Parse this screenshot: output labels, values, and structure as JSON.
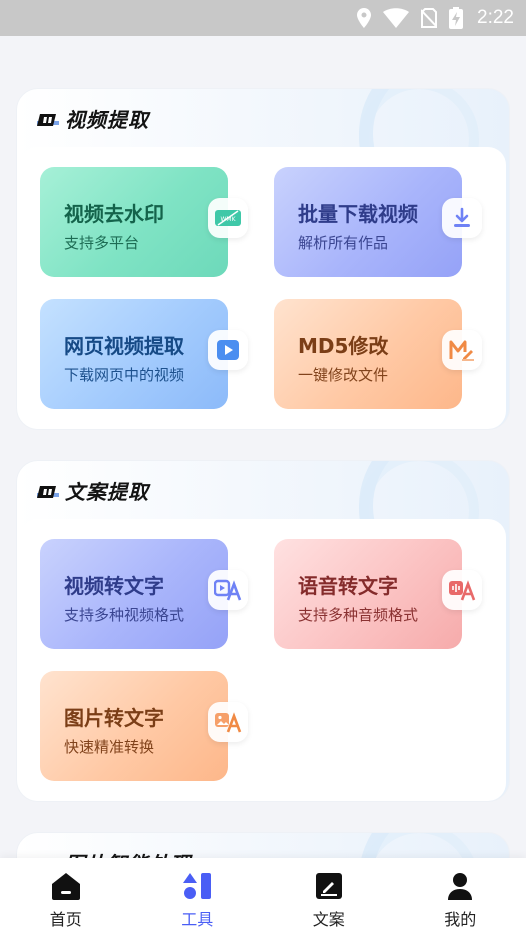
{
  "status_bar": {
    "time": "2:22"
  },
  "sections": [
    {
      "title": "视频提取",
      "cards": [
        {
          "title": "视频去水印",
          "subtitle": "支持多平台",
          "icon": "remove-watermark-icon"
        },
        {
          "title": "批量下载视频",
          "subtitle": "解析所有作品",
          "icon": "download-icon"
        },
        {
          "title": "网页视频提取",
          "subtitle": "下载网页中的视频",
          "icon": "play-icon"
        },
        {
          "title": "MD5修改",
          "subtitle": "一键修改文件",
          "icon": "md5-edit-icon"
        }
      ]
    },
    {
      "title": "文案提取",
      "cards": [
        {
          "title": "视频转文字",
          "subtitle": "支持多种视频格式",
          "icon": "video-to-text-icon"
        },
        {
          "title": "语音转文字",
          "subtitle": "支持多种音频格式",
          "icon": "audio-to-text-icon"
        },
        {
          "title": "图片转文字",
          "subtitle": "快速精准转换",
          "icon": "image-to-text-icon"
        }
      ]
    },
    {
      "title": "图片智能处理"
    }
  ],
  "bottom_nav": [
    {
      "label": "首页",
      "icon": "home-icon",
      "active": false
    },
    {
      "label": "工具",
      "icon": "tools-icon",
      "active": true
    },
    {
      "label": "文案",
      "icon": "notes-icon",
      "active": false
    },
    {
      "label": "我的",
      "icon": "profile-icon",
      "active": false
    }
  ],
  "colors": {
    "accent": "#4a5ef5",
    "status_bar": "#c8c8c8"
  }
}
